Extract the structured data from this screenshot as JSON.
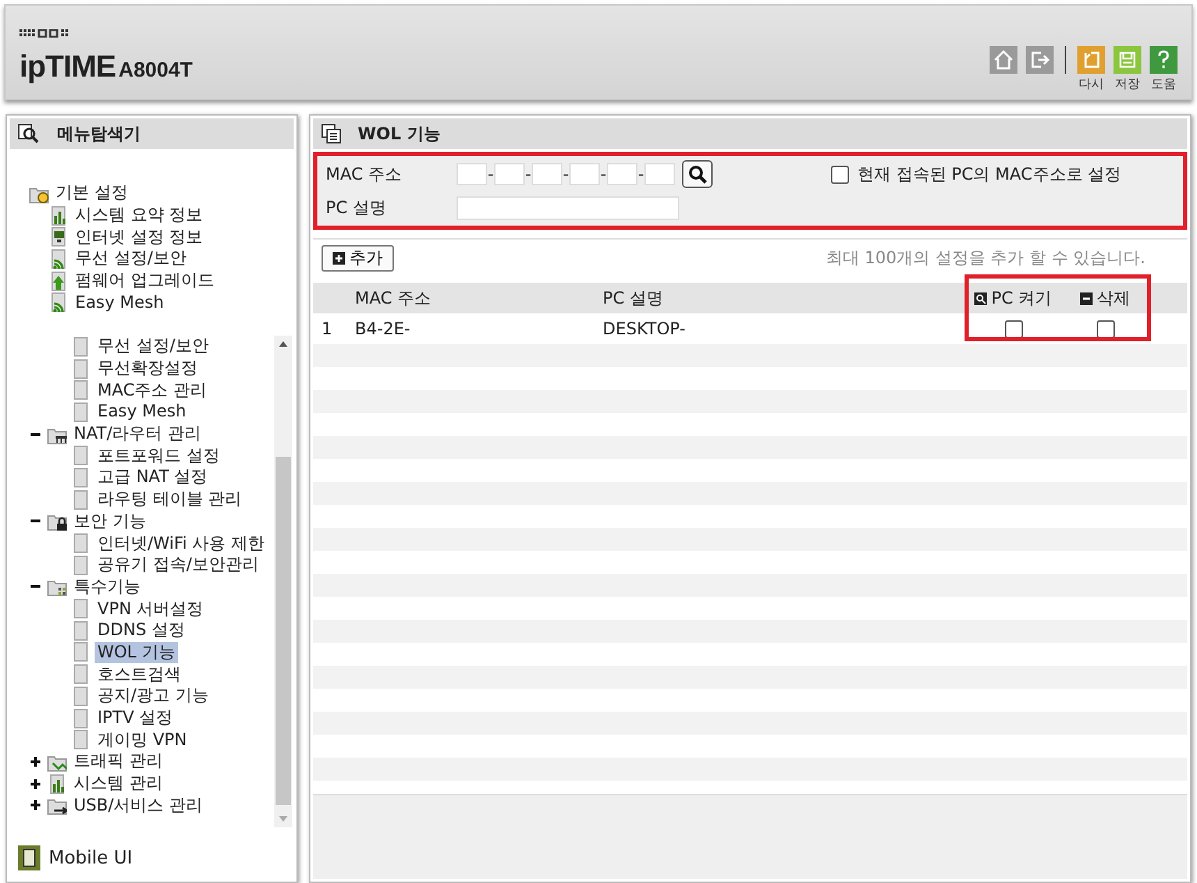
{
  "header": {
    "brand": "ipTIME",
    "model": "A8004T",
    "toolbar": [
      {
        "kind": "home",
        "color": "#9a9a9a"
      },
      {
        "kind": "logout",
        "color": "#9a9a9a"
      },
      {
        "kind": "undo",
        "label": "다시",
        "color": "#e0a030"
      },
      {
        "kind": "save",
        "label": "저장",
        "color": "#8cc63f"
      },
      {
        "kind": "help",
        "label": "도움",
        "color": "#3f9a3f"
      }
    ]
  },
  "sidebar": {
    "title": "메뉴탐색기",
    "top_tree": [
      {
        "label": "기본 설정",
        "kind": "folder",
        "children": [
          {
            "label": "시스템 요약 정보",
            "kind": "chart",
            "selected": false
          },
          {
            "label": "인터넷 설정 정보",
            "kind": "monitor",
            "selected": false
          },
          {
            "label": "무선 설정/보안",
            "kind": "wifi",
            "selected": false
          },
          {
            "label": "펌웨어 업그레이드",
            "kind": "upgrade",
            "selected": false
          },
          {
            "label": "Easy Mesh",
            "kind": "wifi",
            "selected": false
          }
        ]
      }
    ],
    "scroll_tree": [
      {
        "children": [
          {
            "label": "무선 설정/보안",
            "kind": "page",
            "selected": false
          },
          {
            "label": "무선확장설정",
            "kind": "page",
            "selected": false
          },
          {
            "label": "MAC주소 관리",
            "kind": "page",
            "selected": false
          },
          {
            "label": "Easy Mesh",
            "kind": "page",
            "selected": false
          }
        ]
      },
      {
        "label": "NAT/라우터 관리",
        "kind": "network",
        "expanded": true,
        "children": [
          {
            "label": "포트포워드 설정",
            "kind": "page",
            "selected": false
          },
          {
            "label": "고급 NAT 설정",
            "kind": "page",
            "selected": false
          },
          {
            "label": "라우팅 테이블 관리",
            "kind": "page",
            "selected": false
          }
        ]
      },
      {
        "label": "보안 기능",
        "kind": "lock",
        "expanded": true,
        "children": [
          {
            "label": "인터넷/WiFi 사용 제한",
            "kind": "page",
            "selected": false
          },
          {
            "label": "공유기 접속/보안관리",
            "kind": "page",
            "selected": false
          }
        ]
      },
      {
        "label": "특수기능",
        "kind": "grid",
        "expanded": true,
        "children": [
          {
            "label": "VPN 서버설정",
            "kind": "page",
            "selected": false
          },
          {
            "label": "DDNS 설정",
            "kind": "page",
            "selected": false
          },
          {
            "label": "WOL 기능",
            "kind": "page",
            "selected": true
          },
          {
            "label": "호스트검색",
            "kind": "page",
            "selected": false
          },
          {
            "label": "공지/광고 기능",
            "kind": "page",
            "selected": false
          },
          {
            "label": "IPTV 설정",
            "kind": "page",
            "selected": false
          },
          {
            "label": "게이밍 VPN",
            "kind": "page",
            "selected": false
          }
        ]
      },
      {
        "label": "트래픽 관리",
        "kind": "traffic",
        "expanded": false
      },
      {
        "label": "시스템 관리",
        "kind": "chart",
        "expanded": false
      },
      {
        "label": "USB/서비스 관리",
        "kind": "usb",
        "expanded": false
      }
    ],
    "footer_link": "Mobile UI"
  },
  "panel": {
    "title": "WOL 기능",
    "form": {
      "highlighted": true,
      "mac_label": "MAC 주소",
      "mac_separators": [
        "-",
        "-",
        "-",
        "-",
        "-"
      ],
      "desc_label": "PC 설명",
      "use_current": {
        "label": "현재 접속된 PC의 MAC주소로 설정",
        "checked": false
      }
    },
    "add_button": "추가",
    "limit_note": "최대 100개의 설정을 추가 할 수 있습니다.",
    "table": {
      "action_columns_highlighted": true,
      "columns": [
        {
          "label": "MAC 주소"
        },
        {
          "label": "PC 설명"
        },
        {
          "label": "PC 켜기",
          "kind": "wake"
        },
        {
          "label": "삭제",
          "kind": "delete"
        }
      ],
      "rows": [
        {
          "index": "1",
          "mac": "B4-2E-",
          "description": "DESKTOP-",
          "wake_checked": false,
          "delete_checked": false
        }
      ]
    }
  }
}
